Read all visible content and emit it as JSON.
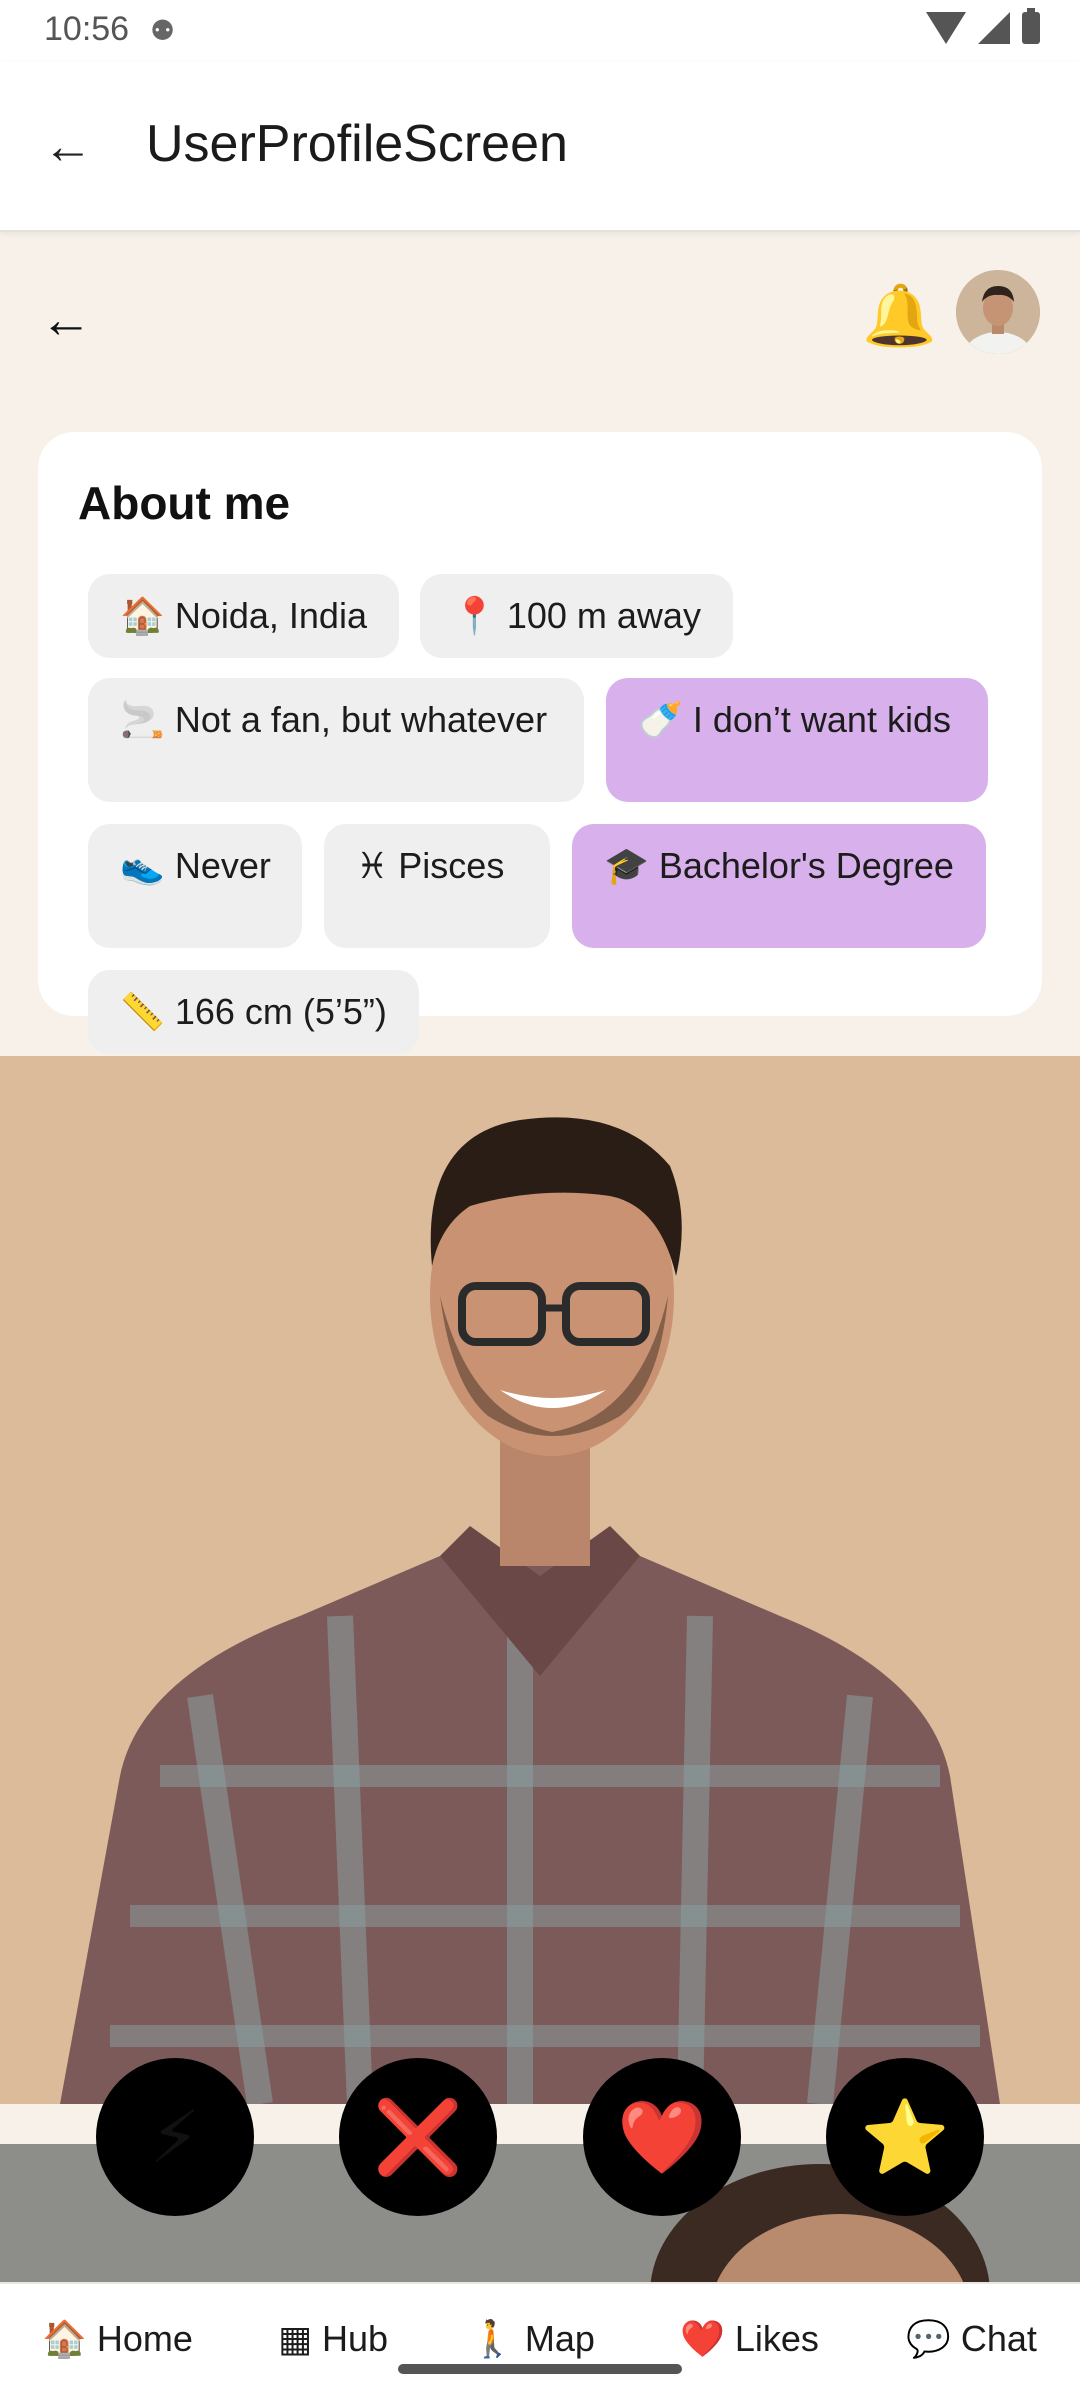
{
  "status_bar": {
    "time": "10:56",
    "extra_icon": "⚉"
  },
  "app_bar": {
    "title": "UserProfileScreen",
    "back_icon": "←"
  },
  "header": {
    "back_glyph": "←",
    "bell_glyph": "🔔"
  },
  "about": {
    "title": "About me",
    "chips": [
      {
        "icon": "🏠",
        "label": "Noida, India",
        "selected": false
      },
      {
        "icon": "📍",
        "label": "100 m away",
        "selected": false
      },
      {
        "icon": "🚬",
        "label": "Not a fan, but whatever",
        "selected": false
      },
      {
        "icon": "🍼",
        "label": "I don’t want kids",
        "selected": true
      },
      {
        "icon": "👟",
        "label": "Never",
        "selected": false
      },
      {
        "icon": "♓",
        "label": "Pisces",
        "selected": false
      },
      {
        "icon": "🎓",
        "label": "Bachelor's Degree",
        "selected": true
      },
      {
        "icon": "📏",
        "label": "166 cm (5’5”)",
        "selected": false
      }
    ]
  },
  "actions": [
    {
      "name": "boost",
      "glyph": "⚡"
    },
    {
      "name": "dislike",
      "glyph": "❌"
    },
    {
      "name": "like",
      "glyph": "❤️"
    },
    {
      "name": "superlike",
      "glyph": "⭐"
    }
  ],
  "nav": [
    {
      "icon": "🏠",
      "label": "Home"
    },
    {
      "icon": "▦",
      "label": "Hub"
    },
    {
      "icon": "🚶",
      "label": "Map"
    },
    {
      "icon": "❤️",
      "label": "Likes"
    },
    {
      "icon": "💬",
      "label": "Chat"
    }
  ]
}
